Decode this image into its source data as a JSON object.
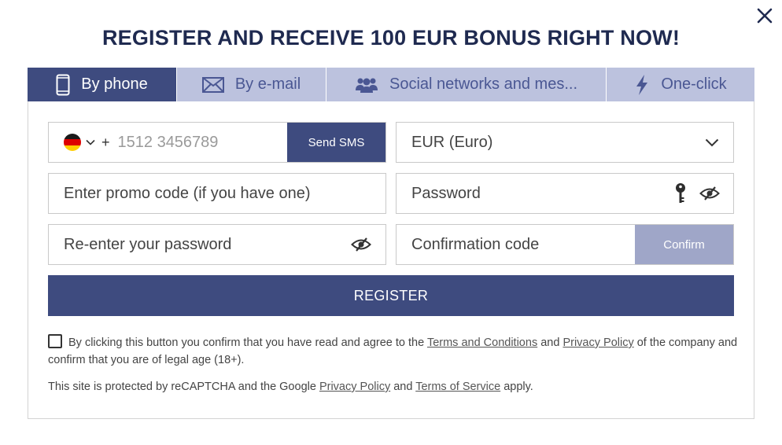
{
  "title": "REGISTER AND RECEIVE 100 EUR BONUS RIGHT NOW!",
  "tabs": [
    {
      "label": "By phone",
      "icon": "phone-icon"
    },
    {
      "label": "By e-mail",
      "icon": "envelope-icon"
    },
    {
      "label": "Social networks and mes...",
      "icon": "users-icon"
    },
    {
      "label": "One-click",
      "icon": "lightning-icon"
    }
  ],
  "form": {
    "phone": {
      "country_flag": "germany-flag",
      "prefix": "+",
      "placeholder": "1512 3456789",
      "send_sms_label": "Send SMS"
    },
    "currency": {
      "value": "EUR (Euro)"
    },
    "promo_placeholder": "Enter promo code (if you have one)",
    "password_placeholder": "Password",
    "repassword_placeholder": "Re-enter your password",
    "confirmation_placeholder": "Confirmation code",
    "confirm_label": "Confirm",
    "register_label": "REGISTER"
  },
  "agreement": {
    "text_before": "By clicking this button you confirm that you have read and agree to the ",
    "terms_link": "Terms and Conditions",
    "text_and": " and ",
    "privacy_link": "Privacy Policy",
    "text_after": " of the company and confirm that you are of legal age (18+)."
  },
  "recaptcha": {
    "text_before": "This site is protected by reCAPTCHA and the Google ",
    "privacy_link": "Privacy Policy",
    "text_and": " and ",
    "tos_link": "Terms of Service",
    "text_after": " apply."
  },
  "colors": {
    "accent": "#3e4b7f",
    "tab_inactive": "#bcc2de",
    "title": "#1f2a50",
    "confirm_disabled": "#9fa6c8"
  }
}
